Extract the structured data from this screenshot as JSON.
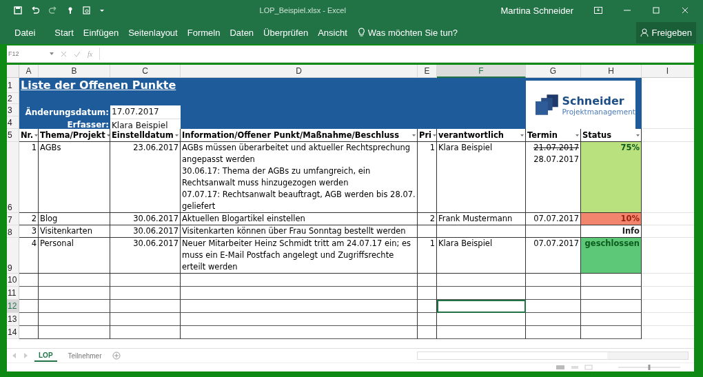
{
  "window": {
    "title": "LOP_Beispiel.xlsx - Excel",
    "user": "Martina Schneider"
  },
  "ribbon_tabs": [
    {
      "label": "Datei",
      "selected": false
    },
    {
      "label": "Start",
      "selected": false
    },
    {
      "label": "Einfügen",
      "selected": false
    },
    {
      "label": "Seitenlayout",
      "selected": false
    },
    {
      "label": "Formeln",
      "selected": false
    },
    {
      "label": "Daten",
      "selected": false
    },
    {
      "label": "Überprüfen",
      "selected": false
    },
    {
      "label": "Ansicht",
      "selected": false
    }
  ],
  "tell_me": "Was möchten Sie tun?",
  "share_button": "Freigeben",
  "formula_bar": {
    "name_box": "F12",
    "function_label": "fx"
  },
  "column_headers": [
    {
      "label": "A",
      "selected": false
    },
    {
      "label": "B",
      "selected": false
    },
    {
      "label": "C",
      "selected": false
    },
    {
      "label": "D",
      "selected": false
    },
    {
      "label": "E",
      "selected": false
    },
    {
      "label": "F",
      "selected": true
    },
    {
      "label": "G",
      "selected": false
    },
    {
      "label": "H",
      "selected": false
    },
    {
      "label": "I",
      "selected": false
    }
  ],
  "row_numbers": [
    {
      "label": "1",
      "selected": false
    },
    {
      "label": "2",
      "selected": false
    },
    {
      "label": "3",
      "selected": false
    },
    {
      "label": "4",
      "selected": false
    },
    {
      "label": "5",
      "selected": false
    },
    {
      "label": "6",
      "selected": false
    },
    {
      "label": "7",
      "selected": false
    },
    {
      "label": "8",
      "selected": false
    },
    {
      "label": "9",
      "selected": false
    },
    {
      "label": "10",
      "selected": false
    },
    {
      "label": "11",
      "selected": false
    },
    {
      "label": "12",
      "selected": true
    },
    {
      "label": "13",
      "selected": false
    },
    {
      "label": "14",
      "selected": false
    }
  ],
  "zoom": {
    "level": 0.5
  },
  "sheet": {
    "title": "Liste der Offenen Punkte",
    "change_date_label": "Änderungsdatum:",
    "change_date": "17.07.2017",
    "author_label": "Erfasser:",
    "author": "Klara Beispiel",
    "logo_name": "Schneider",
    "logo_tagline": "Projektmanagement"
  },
  "table": {
    "columns": [
      "Nr.",
      "Thema/Projekt",
      "Einstelldatum",
      "Information/Offener Punkt/Maßnahme/Beschluss",
      "Pri",
      "verantwortlich",
      "Termin",
      "Status"
    ],
    "rows": [
      {
        "nr": "1",
        "topic": "AGBs",
        "date": "23.06.2017",
        "info": [
          "AGBs müssen überarbeitet und aktueller Rechtsprechung angepasst werden",
          "30.06.17: Thema der AGBs zu umfangreich, ein Rechtsanwalt muss hinzugezogen werden",
          "07.07.17: Rechtsanwalt beauftragt, AGB werden bis 28.07. geliefert"
        ],
        "pri": "1",
        "owner": "Klara Beispiel",
        "deadlines": [
          {
            "text": "21.07.2017",
            "struck": true
          },
          {
            "text": "28.07.2017",
            "struck": false
          }
        ],
        "status": "75%",
        "color": "#b9e27e"
      },
      {
        "nr": "2",
        "topic": "Blog",
        "date": "30.06.2017",
        "info": [
          "Aktuellen Blogartikel einstellen"
        ],
        "pri": "2",
        "owner": "Frank Mustermann",
        "deadlines": [
          {
            "text": "07.07.2017",
            "struck": false
          }
        ],
        "status": "10%",
        "color": "#f2856d"
      },
      {
        "nr": "3",
        "topic": "Visitenkarten",
        "date": "30.06.2017",
        "info": [
          "Visitenkarten können über Frau Sonntag bestellt werden"
        ],
        "deadlines": [],
        "status": "Info",
        "color": "#ffffff"
      },
      {
        "nr": "4",
        "topic": "Personal",
        "date": "30.06.2017",
        "info": [
          "Neuer Mitarbeiter Heinz Schmidt tritt am 24.07.17 ein; es muss ein E-Mail Postfach angelegt und Zugriffsrechte erteilt werden"
        ],
        "pri": "1",
        "owner": "Klara Beispiel",
        "deadlines": [
          {
            "text": "07.07.2017",
            "struck": false
          }
        ],
        "status": "geschlossen",
        "color": "#5dc978"
      }
    ]
  },
  "sheet_tabs": [
    {
      "label": "LOP",
      "selected": true
    },
    {
      "label": "Teilnehmer",
      "selected": false
    }
  ]
}
